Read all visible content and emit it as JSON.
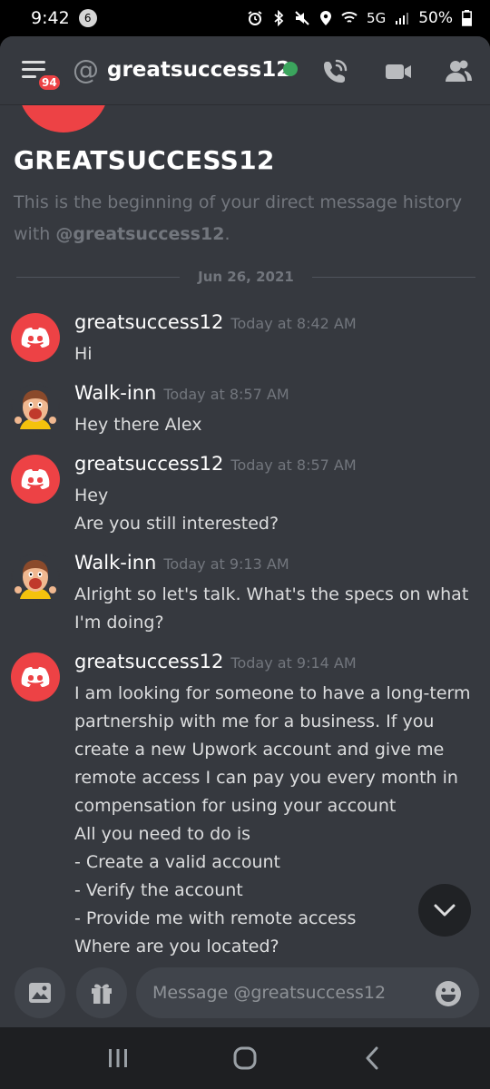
{
  "status_bar": {
    "time": "9:42",
    "notification_count": "6",
    "network": "5G",
    "battery": "50%"
  },
  "header": {
    "menu_badge": "94",
    "at_symbol": "@",
    "channel_name": "greatsuccess12",
    "online_color": "#3ba55d",
    "icons": [
      "phone-call-icon",
      "video-camera-icon",
      "members-icon"
    ]
  },
  "intro": {
    "title": "GREATSUCCESS12",
    "text_prefix": "This is the beginning of your direct message history with ",
    "mention": "@greatsuccess12",
    "text_suffix": "."
  },
  "date_divider": "Jun 26, 2021",
  "messages": [
    {
      "author": "greatsuccess12",
      "time": "Today at 8:42 AM",
      "lines": [
        "Hi"
      ],
      "avatar": "discord-logo-avatar"
    },
    {
      "author": "Walk-inn",
      "time": "Today at 8:57 AM",
      "lines": [
        "Hey there Alex"
      ],
      "avatar": "cartoon-avatar"
    },
    {
      "author": "greatsuccess12",
      "time": "Today at 8:57 AM",
      "lines": [
        "Hey",
        "Are you still interested?"
      ],
      "avatar": "discord-logo-avatar"
    },
    {
      "author": "Walk-inn",
      "time": "Today at 9:13 AM",
      "lines": [
        "Alright so let's talk. What's the specs on what I'm doing?"
      ],
      "avatar": "cartoon-avatar"
    },
    {
      "author": "greatsuccess12",
      "time": "Today at 9:14 AM",
      "lines": [
        "I am looking for someone to have a long-term partnership with me for a business. If you create a new Upwork account and give me remote access I can pay you every month in compensation for using your account",
        "All you need to do is",
        "- Create a valid account",
        "- Verify the account",
        "- Provide me with remote access",
        "Where are you located?"
      ],
      "avatar": "discord-logo-avatar"
    }
  ],
  "composer": {
    "placeholder": "Message @greatsuccess12"
  },
  "colors": {
    "background": "#36393f",
    "brand_red": "#ed4245",
    "muted": "#72767d"
  }
}
